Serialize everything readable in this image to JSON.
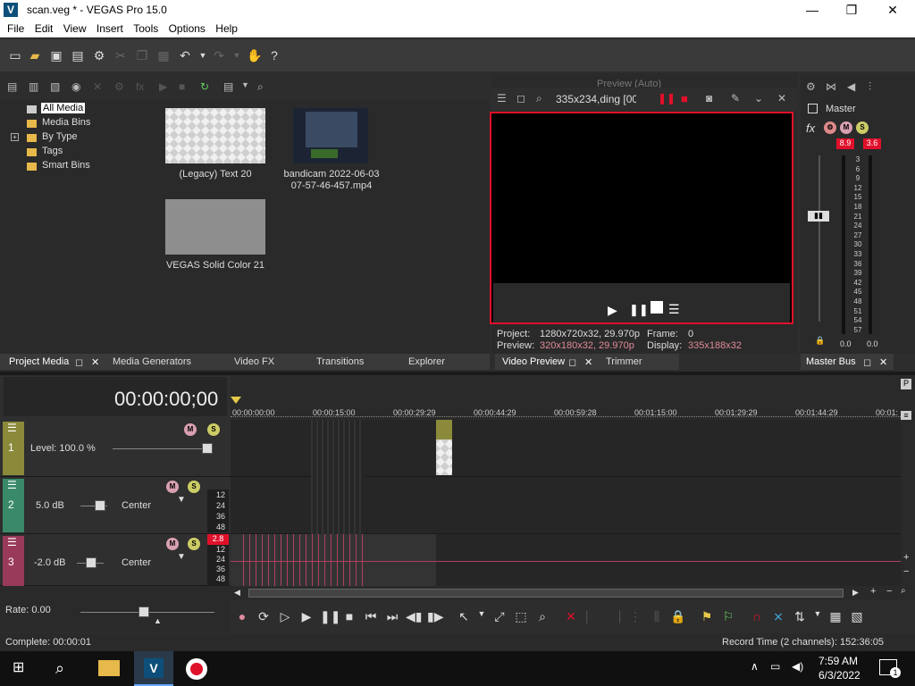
{
  "window": {
    "title": "scan.veg * - VEGAS Pro 15.0",
    "minimize": "—",
    "maximize": "❐",
    "close": "✕"
  },
  "menu": [
    "File",
    "Edit",
    "View",
    "Insert",
    "Tools",
    "Options",
    "Help"
  ],
  "media_tree": {
    "items": [
      "All Media",
      "Media Bins",
      "By Type",
      "Tags",
      "Smart Bins"
    ]
  },
  "media_files": [
    {
      "name": "(Legacy) Text 20"
    },
    {
      "name_line1": "bandicam 2022-06-03",
      "name_line2": "07-57-46-457.mp4"
    },
    {
      "name": "VEGAS Solid Color 21"
    }
  ],
  "left_tabs": [
    "Project Media",
    "Media Generators",
    "Video FX",
    "Transitions",
    "Explorer"
  ],
  "preview": {
    "resolution_text": "335x234,ding [00:",
    "toolbar_faded": "Preview (Auto)",
    "project_label": "Project:",
    "project_value": "1280x720x32, 29.970p",
    "preview_label": "Preview:",
    "preview_value": "320x180x32, 29.970p",
    "frame_label": "Frame:",
    "frame_value": "0",
    "display_label": "Display:",
    "display_value": "335x188x32",
    "tabs": [
      "Video Preview",
      "Trimmer"
    ]
  },
  "master": {
    "label": "Master",
    "peak_left": "8.9",
    "peak_right": "3.6",
    "scale": [
      "3",
      "6",
      "9",
      "12",
      "15",
      "18",
      "21",
      "24",
      "27",
      "30",
      "33",
      "36",
      "39",
      "42",
      "45",
      "48",
      "51",
      "54",
      "57"
    ],
    "bottom_left": "0.0",
    "bottom_right": "0.0",
    "tab": "Master Bus"
  },
  "timeline": {
    "timecode": "00:00:00;00",
    "ruler": [
      "00:00:00:00",
      "00:00:15:00",
      "00:00:29:29",
      "00:00:44:29",
      "00:00:59:28",
      "00:01:15:00",
      "00:01:29:29",
      "00:01:44:29",
      "00:01:"
    ],
    "tracks": [
      {
        "num": "1",
        "label": "Level: 100.0 %",
        "color": "#8a8a3a"
      },
      {
        "num": "2",
        "vol": "5.0 dB",
        "pan": "Center",
        "color": "#3a8a6a"
      },
      {
        "num": "3",
        "vol": "-2.0 dB",
        "pan": "Center",
        "color": "#9a3a5a",
        "peak": "2.8"
      }
    ],
    "meter_ticks": [
      "12",
      "24",
      "36",
      "48"
    ],
    "rate": "Rate: 0.00"
  },
  "status": {
    "left": "Complete: 00:00:01",
    "right": "Record Time (2 channels): 152:36:05"
  },
  "taskbar": {
    "time": "7:59 AM",
    "date": "6/3/2022",
    "notif": "1"
  },
  "colors": {
    "accent_red": "#e0102a",
    "track1": "#8a8a3a",
    "track2": "#3a8a6a",
    "track3": "#9a3a5a"
  }
}
